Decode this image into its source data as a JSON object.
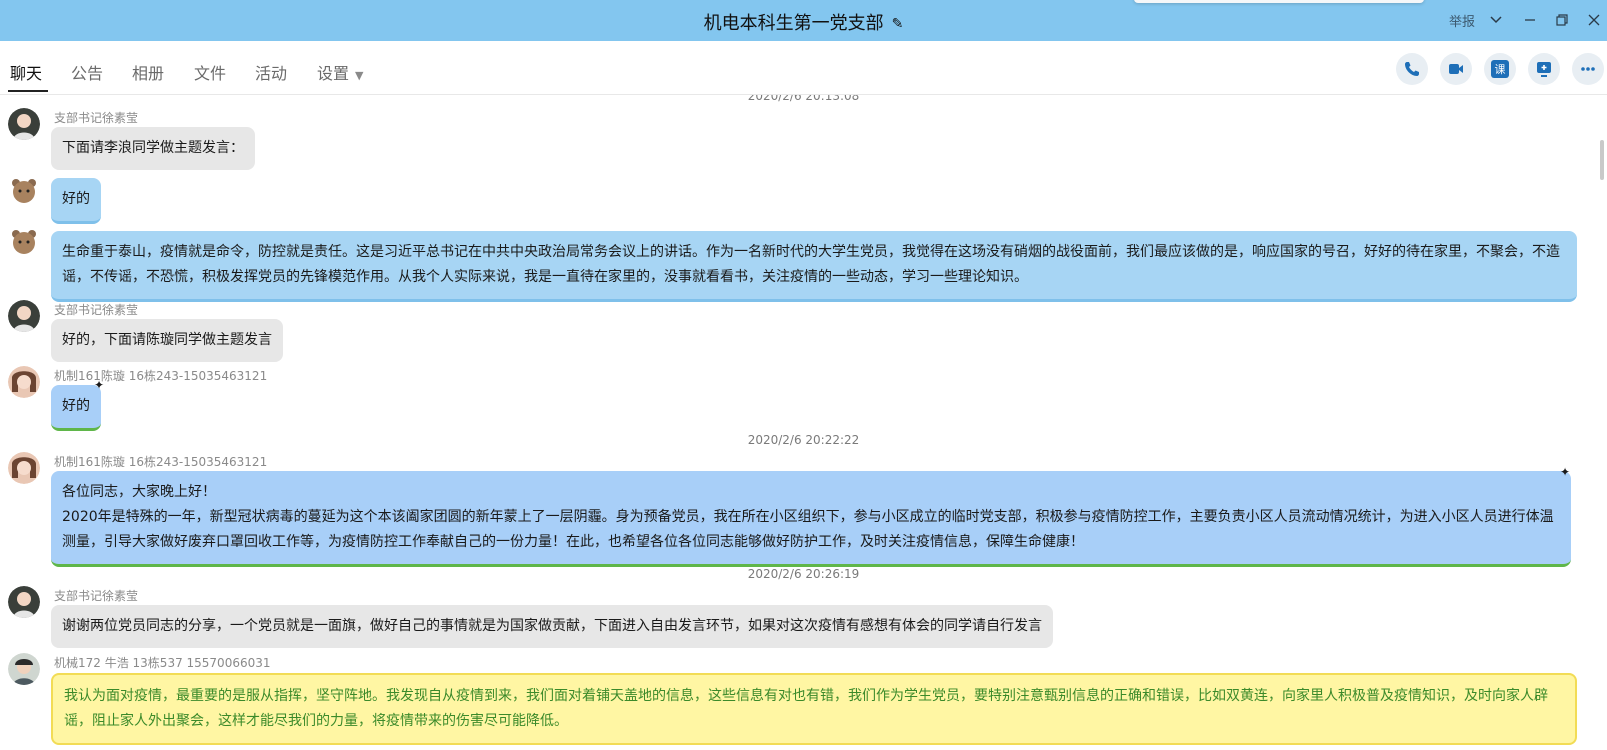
{
  "window": {
    "title": "机电本科生第一党支部",
    "report_label": "举报"
  },
  "tabs": [
    {
      "label": "聊天",
      "active": true
    },
    {
      "label": "公告"
    },
    {
      "label": "相册"
    },
    {
      "label": "文件"
    },
    {
      "label": "活动"
    },
    {
      "label": "设置"
    }
  ],
  "toolbar": {
    "call_icon": "phone-icon",
    "video_icon": "video-icon",
    "class_label": "课",
    "screen_icon": "screen-share-icon",
    "more_icon": "more-icon"
  },
  "messages": [
    {
      "time": "2020/2/6 20:13:08"
    },
    {
      "sender": "支部书记徐素莹",
      "text": "下面请李浪同学做主题发言：",
      "style": "gray"
    },
    {
      "sender": "",
      "text": "好的",
      "style": "blue"
    },
    {
      "sender": "",
      "text": "生命重于泰山，疫情就是命令，防控就是责任。这是习近平总书记在中共中央政治局常务会议上的讲话。作为一名新时代的大学生党员，我觉得在这场没有硝烟的战役面前，我们最应该做的是，响应国家的号召，好好的待在家里，不聚会，不造谣，不传谣，不恐慌，积极发挥党员的先锋模范作用。从我个人实际来说，我是一直待在家里的，没事就看看书，关注疫情的一些动态，学习一些理论知识。",
      "style": "blue"
    },
    {
      "sender": "支部书记徐素莹",
      "text": "好的，下面请陈璇同学做主题发言",
      "style": "gray"
    },
    {
      "sender": "机制161陈璇 16栋243-15035463121",
      "text": "好的",
      "style": "blue2"
    },
    {
      "time": "2020/2/6 20:22:22"
    },
    {
      "sender": "机制161陈璇 16栋243-15035463121",
      "text": "各位同志，大家晚上好！",
      "text2": "2020年是特殊的一年，新型冠状病毒的蔓延为这个本该阖家团圆的新年蒙上了一层阴霾。身为预备党员，我在所在小区组织下，参与小区成立的临时党支部，积极参与疫情防控工作，主要负责小区人员流动情况统计，为进入小区人员进行体温测量，引导大家做好废弃口罩回收工作等，为疫情防控工作奉献自己的一份力量！在此，也希望各位各位同志能够做好防护工作，及时关注疫情信息，保障生命健康！",
      "style": "blue2"
    },
    {
      "time": "2020/2/6 20:26:19"
    },
    {
      "sender": "支部书记徐素莹",
      "text": "谢谢两位党员同志的分享，一个党员就是一面旗，做好自己的事情就是为国家做贡献，下面进入自由发言环节，如果对这次疫情有感想有体会的同学请自行发言",
      "style": "gray"
    },
    {
      "sender": "机械172 牛浩 13栋537 15570066031",
      "text": "我认为面对疫情，最重要的是服从指挥，坚守阵地。我发现自从疫情到来，我们面对着铺天盖地的信息，这些信息有对也有错，我们作为学生党员，要特别注意甄别信息的正确和错误，比如双黄连，向家里人积极普及疫情知识，及时向家人辟谣，阻止家人外出聚会，这样才能尽我们的力量，将疫情带来的伤害尽可能降低。",
      "style": "yellow"
    }
  ],
  "colors": {
    "titlebar": "#83c6ef",
    "bubble_gray": "#e7e7e7",
    "bubble_blue": "#a7d5f4",
    "bubble_blue2": "#a8cff8",
    "bubble_yellow": "#fff6a3"
  }
}
